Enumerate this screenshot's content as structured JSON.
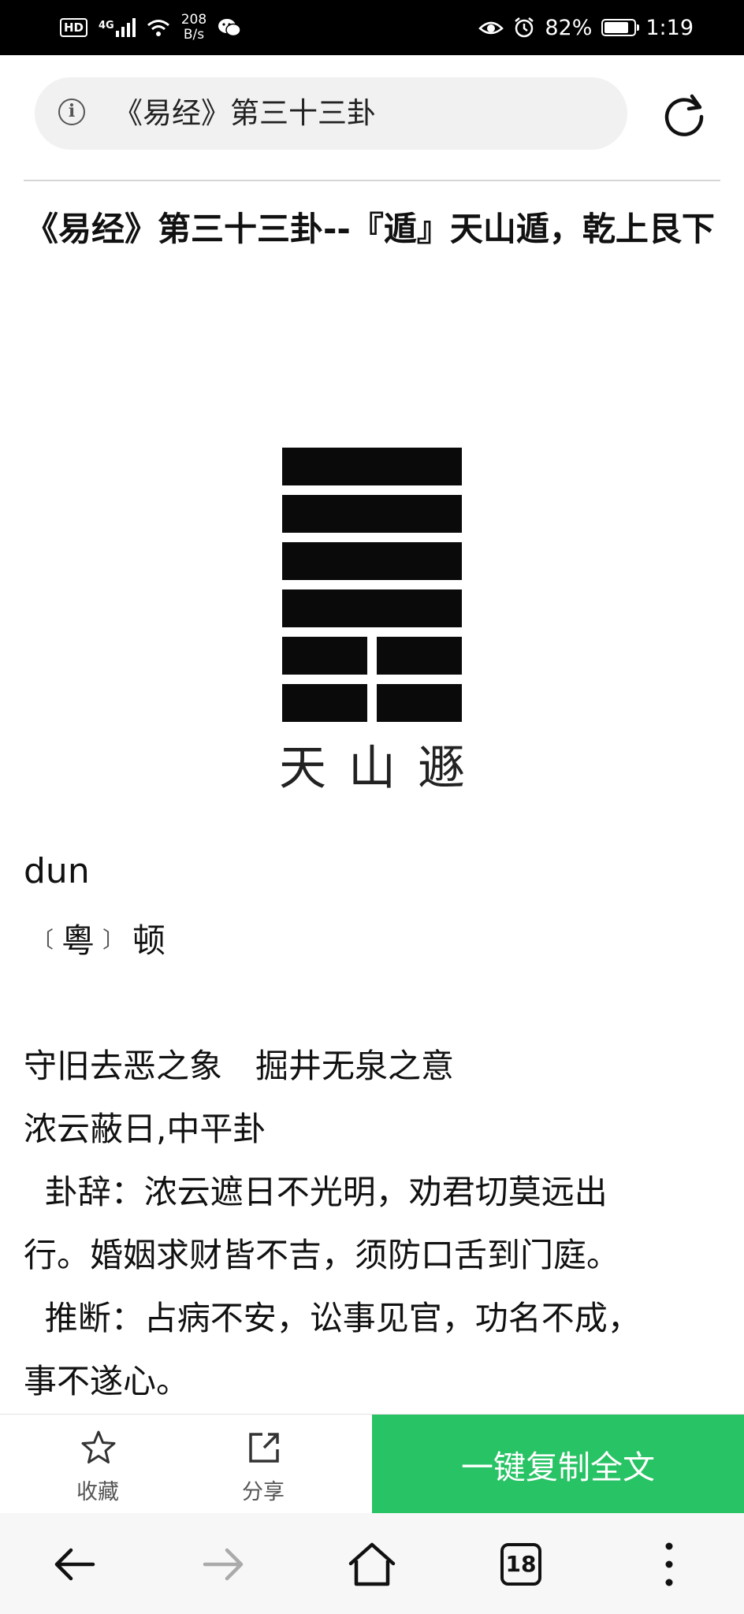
{
  "status_bar": {
    "hd": "HD",
    "network": "4G",
    "speed_value": "208",
    "speed_unit": "B/s",
    "battery_percent": "82%",
    "battery_level": 0.82,
    "time": "1:19"
  },
  "address_bar": {
    "url_text": "《易经》第三十三卦",
    "icons": [
      "info-icon",
      "reload-icon"
    ]
  },
  "article": {
    "title": "《易经》第三十三卦--『遁』天山遁，乾上艮下",
    "hexagram": {
      "lines_top_to_bottom": [
        "yang",
        "yang",
        "yang",
        "yang",
        "yin",
        "yin"
      ],
      "name_chars": [
        "天",
        "山",
        "遯"
      ]
    },
    "pinyin": "dun",
    "yue_label": "粵",
    "yue_reading": "顿",
    "paragraphs": [
      "守旧去恶之象　掘井无泉之意",
      "浓云蔽日,中平卦",
      "  卦辞：浓云遮日不光明，劝君切莫远出",
      "行。婚姻求财皆不吉，须防口舌到门庭。",
      "  推断：占病不安，讼事见官，功名不成，",
      "事不遂心。"
    ]
  },
  "toolbar": {
    "favorite_label": "收藏",
    "share_label": "分享",
    "copy_all_label": "一键复制全文",
    "accent_color": "#27c364"
  },
  "nav_bar": {
    "tab_count": "18",
    "icons": [
      "back-arrow-icon",
      "forward-arrow-icon",
      "home-icon",
      "tabs-icon",
      "more-icon"
    ]
  }
}
